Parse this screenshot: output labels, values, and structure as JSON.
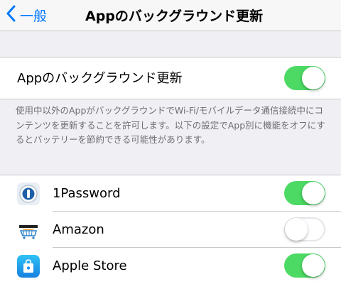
{
  "nav": {
    "back_label": "一般",
    "title": "Appのバックグラウンド更新"
  },
  "master": {
    "label": "Appのバックグラウンド更新",
    "enabled": true
  },
  "description": "使用中以外のAppがバックグラウンドでWi-Fi/モバイルデータ通信接続中にコンテンツを更新することを許可します。以下の設定でApp別に機能をオフにするとバッテリーを節約できる可能性があります。",
  "apps": [
    {
      "name": "1Password",
      "icon": "onepassword-icon",
      "enabled": true
    },
    {
      "name": "Amazon",
      "icon": "amazon-icon",
      "enabled": false
    },
    {
      "name": "Apple Store",
      "icon": "apple-store-icon",
      "enabled": true
    }
  ],
  "colors": {
    "accent": "#007aff",
    "toggle_on": "#4cd964",
    "background": "#efeff4"
  }
}
